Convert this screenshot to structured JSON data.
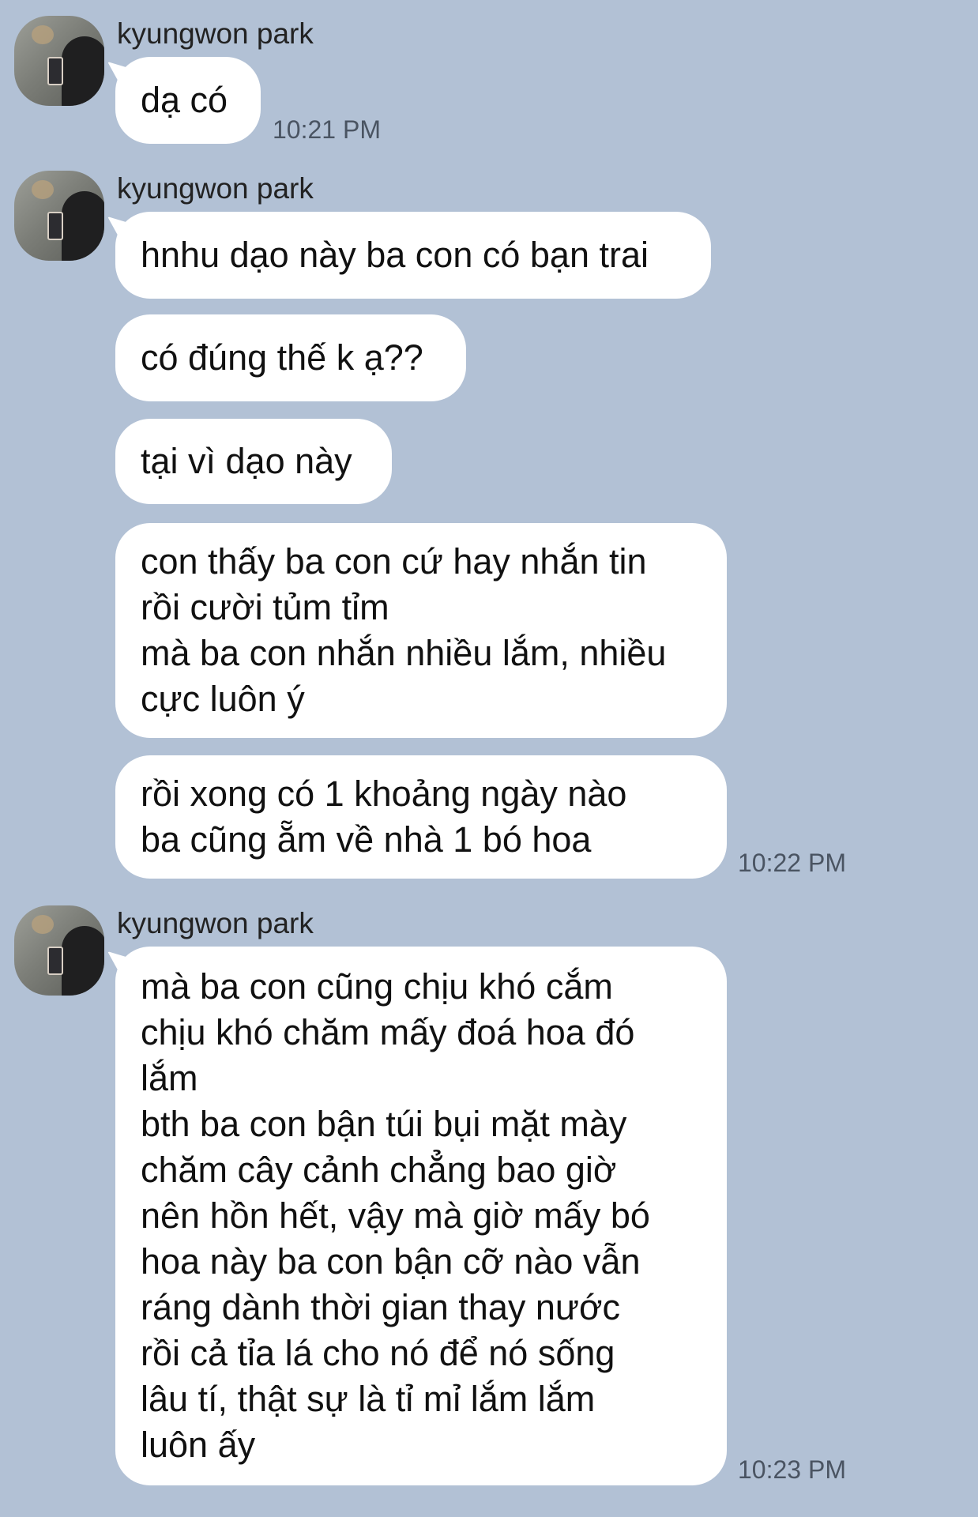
{
  "groups": [
    {
      "sender": "kyungwon park",
      "avatar": "profile-photo-avatar",
      "messages": [
        {
          "lines": [
            "dạ có"
          ]
        }
      ],
      "time": "10:21 PM"
    },
    {
      "sender": "kyungwon park",
      "avatar": "profile-photo-avatar",
      "messages": [
        {
          "lines": [
            "hnhu dạo này ba con có bạn trai"
          ]
        },
        {
          "lines": [
            "có đúng thế k ạ??"
          ]
        },
        {
          "lines": [
            "tại vì dạo này"
          ]
        },
        {
          "lines": [
            "con thấy ba con cứ hay nhắn tin",
            "rồi cười tủm tỉm",
            "mà ba con nhắn nhiều lắm, nhiều",
            "cực luôn ý"
          ]
        },
        {
          "lines": [
            "rồi xong có 1 khoảng ngày nào",
            "ba cũng ẵm về nhà 1 bó hoa"
          ]
        }
      ],
      "time": "10:22 PM"
    },
    {
      "sender": "kyungwon park",
      "avatar": "profile-photo-avatar",
      "messages": [
        {
          "lines": [
            "mà ba con cũng chịu khó cắm",
            "chịu khó chăm mấy đoá hoa đó",
            "lắm",
            "bth ba con bận túi bụi mặt mày",
            "chăm cây cảnh chẳng bao giờ",
            "nên hồn hết, vậy mà giờ mấy bó",
            "hoa này ba con bận cỡ nào vẫn",
            "ráng dành thời gian thay nước",
            "rồi cả tỉa lá cho nó để nó sống",
            "lâu tí, thật sự là tỉ mỉ lắm lắm",
            "luôn ấy"
          ]
        }
      ],
      "time": "10:23 PM"
    }
  ]
}
